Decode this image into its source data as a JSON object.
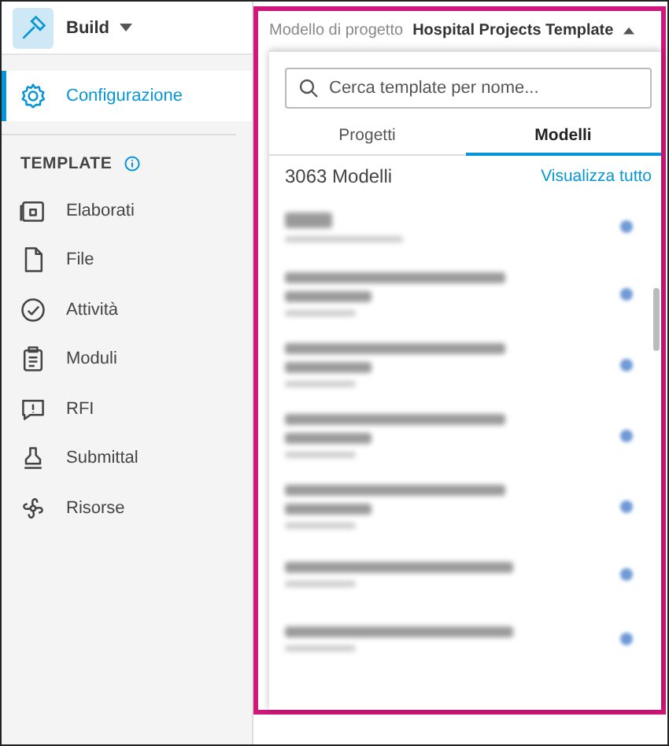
{
  "sidebar": {
    "product": "Build",
    "items_top": [
      {
        "label": "Configurazione",
        "selected": true
      }
    ],
    "section": "TEMPLATE",
    "items": [
      {
        "label": "Elaborati",
        "selected": false
      },
      {
        "label": "File",
        "selected": false
      },
      {
        "label": "Attività",
        "selected": false
      },
      {
        "label": "Moduli",
        "selected": false
      },
      {
        "label": "RFI",
        "selected": false
      },
      {
        "label": "Submittal",
        "selected": false
      },
      {
        "label": "Risorse",
        "selected": false
      }
    ]
  },
  "header": {
    "label": "Modello di progetto",
    "value": "Hospital Projects Template",
    "expanded": true
  },
  "dropdown": {
    "search": {
      "placeholder": "Cerca template per nome..."
    },
    "tabs": [
      {
        "label": "Progetti",
        "selected": false
      },
      {
        "label": "Modelli",
        "selected": true
      }
    ],
    "count": "3063 Modelli",
    "link": "Visualizza tutto",
    "rows": [
      {
        "kind": "short"
      },
      {
        "kind": "two_line"
      },
      {
        "kind": "two_line"
      },
      {
        "kind": "two_line"
      },
      {
        "kind": "two_line"
      },
      {
        "kind": "one_line"
      },
      {
        "kind": "one_line"
      }
    ]
  }
}
